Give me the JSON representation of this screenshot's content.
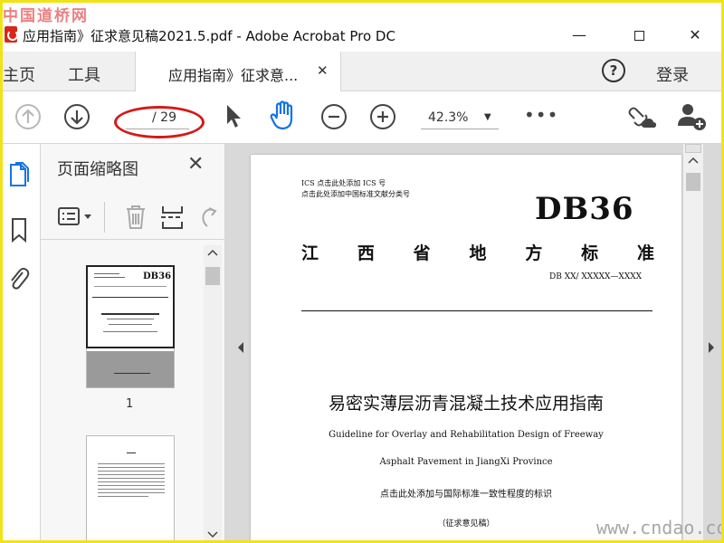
{
  "watermark": {
    "top": "中国道桥网",
    "bottom": "www.cndao.com"
  },
  "window": {
    "title": "应用指南》征求意见稿2021.5.pdf - Adobe Acrobat Pro DC",
    "min": "—",
    "close": "✕"
  },
  "tabs": {
    "home": "主页",
    "tools": "工具",
    "doc": "应用指南》征求意...",
    "doc_close": "✕"
  },
  "header": {
    "help": "?",
    "login": "登录"
  },
  "toolbar": {
    "page_indicator": "/ 29",
    "zoom": "42.3%",
    "zoom_caret": "▼",
    "more": "•••"
  },
  "thumbnail_panel": {
    "title": "页面缩略图",
    "close": "✕",
    "page1_label": "1",
    "page1_db": "DB36"
  },
  "document": {
    "ics_line": "ICS  点击此处添加 ICS 号",
    "ccs_line": "点击此处添加中国标准文献分类号",
    "db_code": "DB36",
    "local_standard_chars": [
      "江",
      "西",
      "省",
      "地",
      "方",
      "标",
      "准"
    ],
    "db_number": "DB XX/  XXXXX—XXXX",
    "title_cn": "易密实薄层沥青混凝土技术应用指南",
    "title_en_1": "Guideline for Overlay and Rehabilitation Design of Freeway",
    "title_en_2": "Asphalt Pavement in JiangXi Province",
    "intl_note": "点击此处添加与国际标准一致性程度的标识",
    "draft_note": "（征求意见稿）"
  },
  "colors": {
    "border": "#f2e21a",
    "annotation": "#d41a1a",
    "accent": "#1473e6",
    "pdf_red": "#d9261c"
  }
}
